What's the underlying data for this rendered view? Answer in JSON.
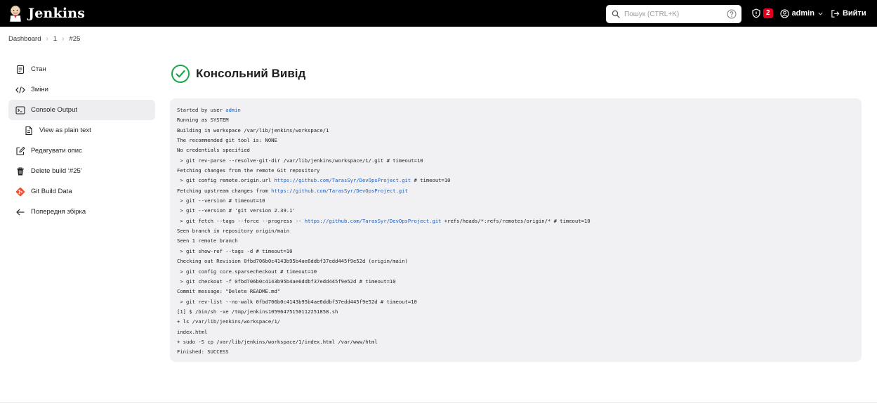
{
  "header": {
    "brand": "Jenkins",
    "search_placeholder": "Пошук (CTRL+K)",
    "security_count": "2",
    "user": "admin",
    "logout": "Вийти"
  },
  "breadcrumb": [
    "Dashboard",
    "1",
    "#25"
  ],
  "sidebar": {
    "items": [
      {
        "label": "Стан",
        "icon": "document-icon"
      },
      {
        "label": "Зміни",
        "icon": "code-icon"
      },
      {
        "label": "Console Output",
        "icon": "terminal-icon"
      },
      {
        "label": "View as plain text",
        "icon": "file-text-icon"
      },
      {
        "label": "Редагувати опис",
        "icon": "edit-icon"
      },
      {
        "label": "Delete build ‘#25’",
        "icon": "trash-icon"
      },
      {
        "label": "Git Build Data",
        "icon": "git-icon"
      },
      {
        "label": "Попередня збірка",
        "icon": "arrow-left-icon"
      }
    ]
  },
  "main": {
    "title": "Консольний Вивід",
    "console_lines": [
      {
        "parts": [
          {
            "t": "Started by user "
          },
          {
            "t": "admin",
            "link": true
          }
        ]
      },
      {
        "parts": [
          {
            "t": "Running as SYSTEM"
          }
        ]
      },
      {
        "parts": [
          {
            "t": "Building in workspace /var/lib/jenkins/workspace/1"
          }
        ]
      },
      {
        "parts": [
          {
            "t": "The recommended git tool is: NONE"
          }
        ]
      },
      {
        "parts": [
          {
            "t": "No credentials specified"
          }
        ]
      },
      {
        "parts": [
          {
            "t": " > git rev-parse --resolve-git-dir /var/lib/jenkins/workspace/1/.git # timeout=10"
          }
        ]
      },
      {
        "parts": [
          {
            "t": "Fetching changes from the remote Git repository"
          }
        ]
      },
      {
        "parts": [
          {
            "t": " > git config remote.origin.url "
          },
          {
            "t": "https://github.com/TarasSyr/DevOpsProject.git",
            "link": true
          },
          {
            "t": " # timeout=10"
          }
        ]
      },
      {
        "parts": [
          {
            "t": "Fetching upstream changes from "
          },
          {
            "t": "https://github.com/TarasSyr/DevOpsProject.git",
            "link": true
          }
        ]
      },
      {
        "parts": [
          {
            "t": " > git --version # timeout=10"
          }
        ]
      },
      {
        "parts": [
          {
            "t": " > git --version # 'git version 2.39.1'"
          }
        ]
      },
      {
        "parts": [
          {
            "t": " > git fetch --tags --force --progress -- "
          },
          {
            "t": "https://github.com/TarasSyr/DevOpsProject.git",
            "link": true
          },
          {
            "t": " +refs/heads/*:refs/remotes/origin/* # timeout=10"
          }
        ]
      },
      {
        "parts": [
          {
            "t": "Seen branch in repository origin/main"
          }
        ]
      },
      {
        "parts": [
          {
            "t": "Seen 1 remote branch"
          }
        ]
      },
      {
        "parts": [
          {
            "t": " > git show-ref --tags -d # timeout=10"
          }
        ]
      },
      {
        "parts": [
          {
            "t": "Checking out Revision 0fbd706b0c4143b95b4ae6ddbf37edd445f9e52d (origin/main)"
          }
        ]
      },
      {
        "parts": [
          {
            "t": " > git config core.sparsecheckout # timeout=10"
          }
        ]
      },
      {
        "parts": [
          {
            "t": " > git checkout -f 0fbd706b0c4143b95b4ae6ddbf37edd445f9e52d # timeout=10"
          }
        ]
      },
      {
        "parts": [
          {
            "t": "Commit message: \"Delete README.md\""
          }
        ]
      },
      {
        "parts": [
          {
            "t": " > git rev-list --no-walk 0fbd706b0c4143b95b4ae6ddbf37edd445f9e52d # timeout=10"
          }
        ]
      },
      {
        "parts": [
          {
            "t": "[1] $ /bin/sh -xe /tmp/jenkins10596475150112251858.sh"
          }
        ]
      },
      {
        "parts": [
          {
            "t": "+ ls /var/lib/jenkins/workspace/1/"
          }
        ]
      },
      {
        "parts": [
          {
            "t": "index.html"
          }
        ]
      },
      {
        "parts": [
          {
            "t": "+ sudo -S cp /var/lib/jenkins/workspace/1/index.html /var/www/html"
          }
        ]
      },
      {
        "parts": [
          {
            "t": "Finished: SUCCESS"
          }
        ]
      }
    ]
  },
  "colors": {
    "header_bg": "#000000",
    "success_green": "#1ea64b",
    "link_blue": "#1b5fbf",
    "badge_red": "#e6001f",
    "console_bg": "#f1f1f3",
    "active_item_bg": "#eeeef0"
  }
}
